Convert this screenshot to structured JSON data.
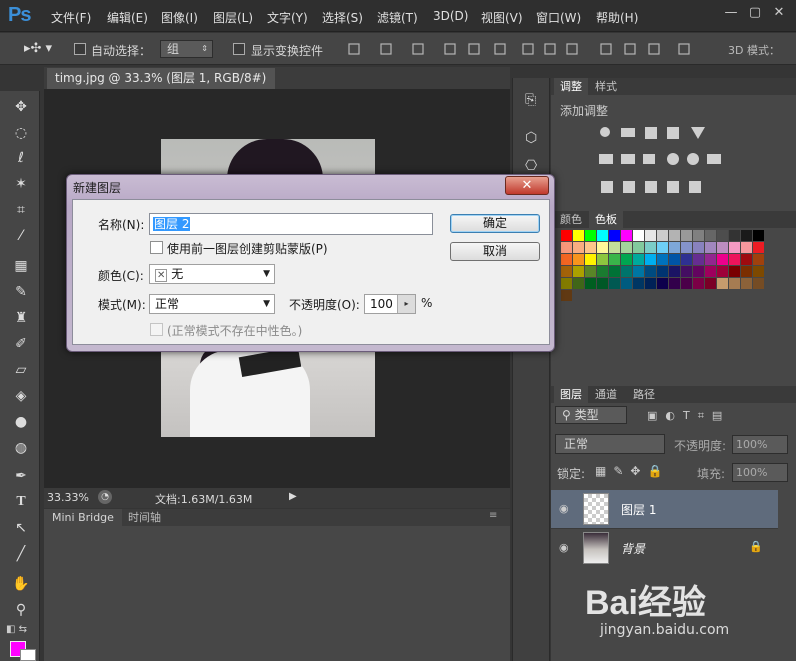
{
  "app": {
    "logo": "Ps"
  },
  "menu": [
    "文件(F)",
    "编辑(E)",
    "图像(I)",
    "图层(L)",
    "文字(Y)",
    "选择(S)",
    "滤镜(T)",
    "3D(D)",
    "视图(V)",
    "窗口(W)",
    "帮助(H)"
  ],
  "window_controls": [
    "—",
    "▢",
    "✕"
  ],
  "options": {
    "auto_select": "自动选择：",
    "auto_select_value": "组",
    "show_transform": "显示变换控件",
    "mode_3d": "3D 模式："
  },
  "document": {
    "tab": "timg.jpg @ 33.3% (图层 1, RGB/8#) *",
    "close": "×",
    "zoom": "33.33%",
    "doc_info": "文档:1.63M/1.63M"
  },
  "bottom_tabs": [
    "Mini Bridge",
    "时间轴"
  ],
  "adjust": {
    "tabs": [
      "调整",
      "样式"
    ],
    "header": "添加调整"
  },
  "swatches": {
    "tabs": [
      "颜色",
      "色板"
    ],
    "colors": [
      "#ff0000",
      "#ffff00",
      "#00ff00",
      "#00ffff",
      "#0000ff",
      "#ff00ff",
      "#ffffff",
      "#e6e6e6",
      "#cccccc",
      "#b3b3b3",
      "#999999",
      "#808080",
      "#666666",
      "#4d4d4d",
      "#333333",
      "#1a1a1a",
      "#000000",
      "#f7977a",
      "#f9ad81",
      "#fdc68a",
      "#fff79a",
      "#c4df9b",
      "#a3d39c",
      "#82ca9d",
      "#7bcdc8",
      "#6ecff6",
      "#7ea7d8",
      "#8493ca",
      "#8882be",
      "#a187be",
      "#bc8dbf",
      "#f49ac2",
      "#f6989d",
      "#ed1c24",
      "#f26522",
      "#f7941d",
      "#fff200",
      "#8dc63f",
      "#39b54a",
      "#00a651",
      "#00a99d",
      "#00aeef",
      "#0072bc",
      "#0054a6",
      "#2e3192",
      "#662d91",
      "#92278f",
      "#ec008c",
      "#ed145b",
      "#9e0b0f",
      "#a0410d",
      "#a36209",
      "#aba000",
      "#598527",
      "#1a7b30",
      "#007236",
      "#00746b",
      "#0076a3",
      "#004b80",
      "#003471",
      "#1b1464",
      "#440e62",
      "#630460",
      "#9e005d",
      "#9e0039",
      "#790000",
      "#7b2e00",
      "#7d4900",
      "#827b00",
      "#406618",
      "#005e20",
      "#005826",
      "#005952",
      "#005b7f",
      "#003663",
      "#002157",
      "#0d004c",
      "#32004b",
      "#4b0049",
      "#7b0046",
      "#7a0026",
      "#c69c6d",
      "#a67c52",
      "#8c6239",
      "#754c24",
      "#603913"
    ]
  },
  "layers": {
    "tabs": [
      "图层",
      "通道",
      "路径"
    ],
    "filter_kind": "类型",
    "blend_mode": "正常",
    "opacity_label": "不透明度:",
    "opacity_value": "100%",
    "lock_label": "锁定:",
    "fill_label": "填充:",
    "fill_value": "100%",
    "items": [
      {
        "name": "图层 1"
      },
      {
        "name": "背景"
      }
    ]
  },
  "dialog": {
    "title": "新建图层",
    "close": "✕",
    "name_label": "名称(N):",
    "name_value": "图层 2",
    "use_prev": "使用前一图层创建剪贴蒙版(P)",
    "color_label": "颜色(C):",
    "color_value": "无",
    "color_x": "✕",
    "mode_label": "模式(M):",
    "mode_value": "正常",
    "opacity_label": "不透明度(O):",
    "opacity_value": "100",
    "percent": "%",
    "neutral": "(正常模式不存在中性色。)",
    "ok": "确定",
    "cancel": "取消"
  },
  "watermark": {
    "main": "Bai经验",
    "url": "jingyan.baidu.com"
  }
}
